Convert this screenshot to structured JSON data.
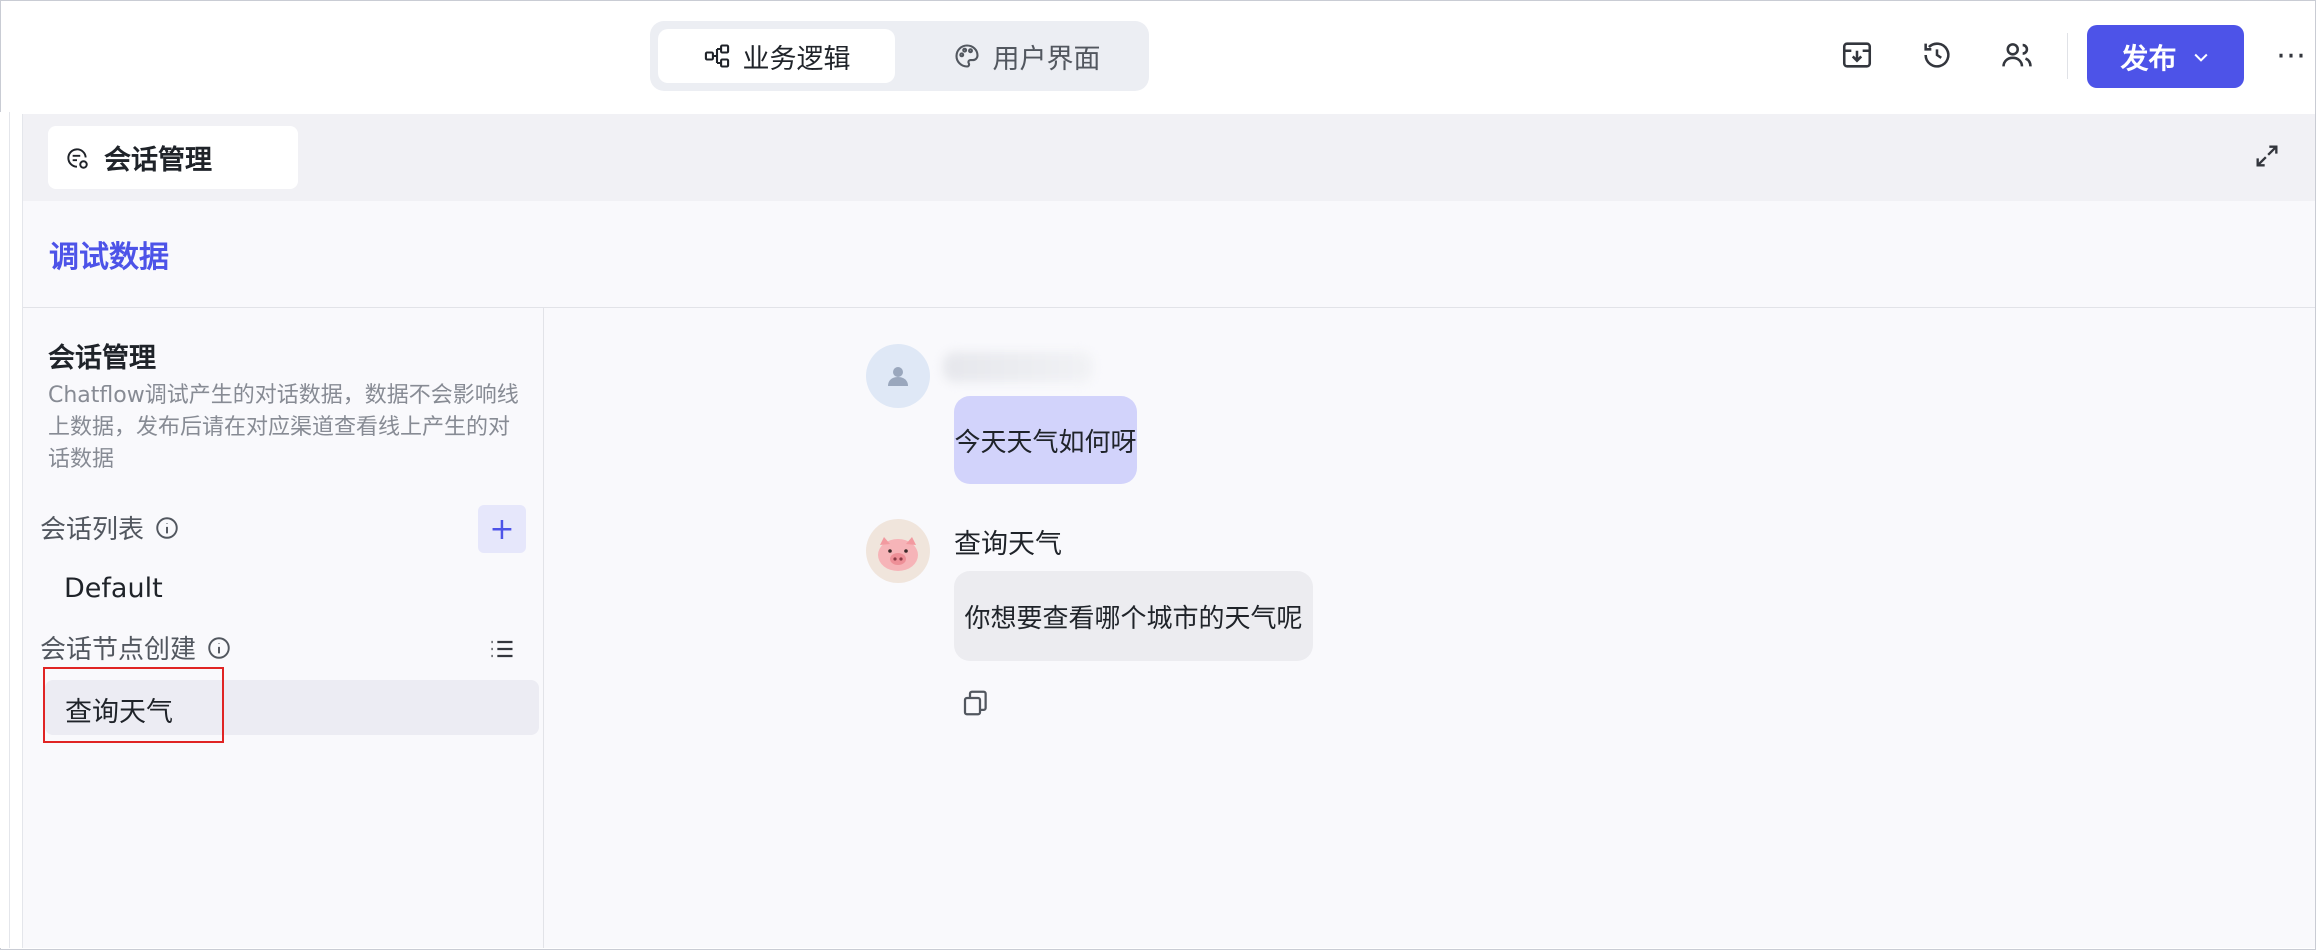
{
  "topbar": {
    "tabs": [
      {
        "label": "业务逻辑",
        "icon": "workflow-icon",
        "active": true
      },
      {
        "label": "用户界面",
        "icon": "palette-icon",
        "active": false
      }
    ],
    "tools": [
      "archive-icon",
      "history-icon",
      "users-icon"
    ],
    "publish_label": "发布",
    "more_label": "⋯"
  },
  "panel": {
    "tab_label": "会话管理",
    "debug_title": "调试数据"
  },
  "sidebar": {
    "title": "会话管理",
    "description": "Chatflow调试产生的对话数据，数据不会影响线上数据，发布后请在对应渠道查看线上产生的对话数据",
    "conversation_list_label": "会话列表",
    "default_item": "Default",
    "node_created_label": "会话节点创建",
    "selected_item": "查询天气"
  },
  "chat": {
    "user_message": "今天天气如何呀",
    "bot_name": "查询天气",
    "bot_message": "你想要查看哪个城市的天气呢"
  },
  "colors": {
    "accent": "#4d53e8",
    "user_bubble": "#d2d3fb",
    "bot_bubble": "#ececf0",
    "highlight": "#e02424"
  }
}
